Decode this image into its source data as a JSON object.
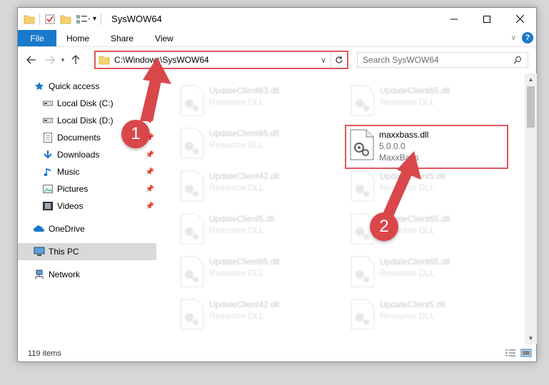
{
  "window": {
    "title": "SysWOW64"
  },
  "ribbon": {
    "file_label": "File",
    "tabs": [
      "Home",
      "Share",
      "View"
    ],
    "help_label": "?"
  },
  "address": {
    "path": "C:\\Windows\\SysWOW64",
    "search_placeholder": "Search SysWOW64"
  },
  "nav": {
    "items": [
      {
        "label": "Quick access",
        "icon": "star-icon",
        "pinned": false
      },
      {
        "label": "Local Disk (C:)",
        "icon": "drive-icon",
        "pinned": true
      },
      {
        "label": "Local Disk (D:)",
        "icon": "drive-icon",
        "pinned": true
      },
      {
        "label": "Documents",
        "icon": "document-icon",
        "pinned": true
      },
      {
        "label": "Downloads",
        "icon": "download-icon",
        "pinned": true
      },
      {
        "label": "Music",
        "icon": "music-icon",
        "pinned": true
      },
      {
        "label": "Pictures",
        "icon": "picture-icon",
        "pinned": true
      },
      {
        "label": "Videos",
        "icon": "video-icon",
        "pinned": true
      },
      {
        "label": "OneDrive",
        "icon": "cloud-icon",
        "pinned": false
      },
      {
        "label": "This PC",
        "icon": "computer-icon",
        "pinned": false,
        "selected": true
      },
      {
        "label": "Network",
        "icon": "network-icon",
        "pinned": false
      }
    ]
  },
  "files": [
    {
      "name": "UpdateClient63.dll",
      "sub": "Resource DLL"
    },
    {
      "name": "UpdateClient65.dll",
      "sub": "Resource DLL"
    },
    {
      "name": "UpdateClient65.dll",
      "sub": "Resource DLL"
    },
    {
      "name": "maxxbass.dll",
      "sub": "5.0.0.0",
      "sub2": "MaxxBass",
      "highlight": true
    },
    {
      "name": "UpdateClient42.dll",
      "sub": "Resource DLL"
    },
    {
      "name": "UpdateClient5.dll",
      "sub": "Resource DLL"
    },
    {
      "name": "UpdateClient5.dll",
      "sub": "Resource DLL"
    },
    {
      "name": "UpdateClient65.dll",
      "sub": "Resource DLL"
    },
    {
      "name": "UpdateClient65.dll",
      "sub": "Resource DLL"
    },
    {
      "name": "UpdateClient65.dll",
      "sub": "Resource DLL"
    },
    {
      "name": "UpdateClient42.dll",
      "sub": "Resource DLL"
    },
    {
      "name": "UpdateClient5.dll",
      "sub": "Resource DLL"
    }
  ],
  "status": {
    "item_count": "119 items"
  },
  "callouts": [
    "1",
    "2"
  ],
  "colors": {
    "accent": "#1979ca",
    "highlight_border": "#e0565b",
    "callout": "#d9474b"
  }
}
